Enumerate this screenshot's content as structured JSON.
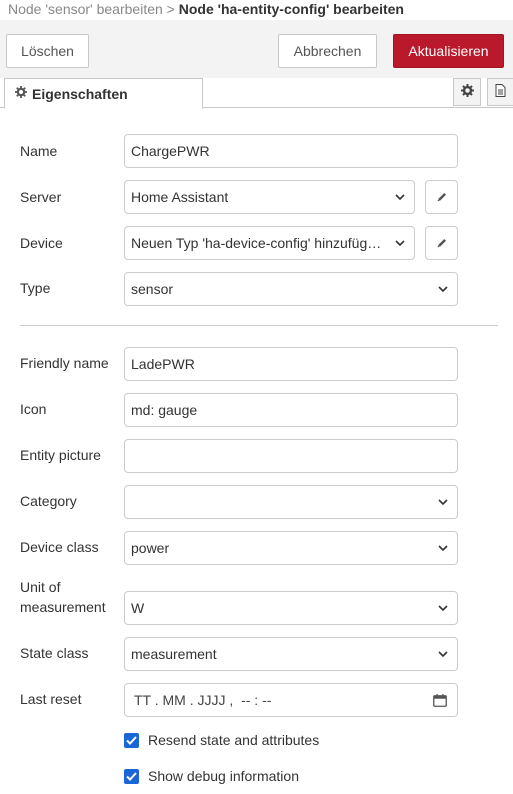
{
  "breadcrumb": {
    "parent": "Node 'sensor' bearbeiten",
    "separator": ">",
    "current": "Node 'ha-entity-config' bearbeiten"
  },
  "toolbar": {
    "delete_label": "Löschen",
    "cancel_label": "Abbrechen",
    "update_label": "Aktualisieren"
  },
  "tabs": {
    "properties_label": "Eigenschaften",
    "properties_icon": "gear-icon",
    "settings_icon": "gear-icon",
    "description_icon": "document-icon"
  },
  "form": {
    "name": {
      "label": "Name",
      "value": "ChargePWR"
    },
    "server": {
      "label": "Server",
      "value": "Home Assistant"
    },
    "device": {
      "label": "Device",
      "value": "Neuen Typ 'ha-device-config' hinzufügen ..."
    },
    "type": {
      "label": "Type",
      "value": "sensor"
    },
    "friendly_name": {
      "label": "Friendly name",
      "value": "LadePWR"
    },
    "icon": {
      "label": "Icon",
      "value": "md: gauge"
    },
    "entity_picture": {
      "label": "Entity picture",
      "value": ""
    },
    "category": {
      "label": "Category",
      "value": ""
    },
    "device_class": {
      "label": "Device class",
      "value": "power"
    },
    "unit_of_measurement": {
      "label_line1": "Unit of",
      "label_line2": "measurement",
      "value": "W"
    },
    "state_class": {
      "label": "State class",
      "value": "measurement"
    },
    "last_reset": {
      "label": "Last reset",
      "placeholder": "TT . MM . JJJJ ,  -- : --"
    },
    "resend_state": {
      "label": "Resend state and attributes",
      "checked": true
    },
    "show_debug": {
      "label": "Show debug information",
      "checked": true
    }
  },
  "colors": {
    "primary_button": "#b9192a",
    "checkbox": "#1a66d6",
    "toolbar_bg": "#f3f3f3"
  }
}
